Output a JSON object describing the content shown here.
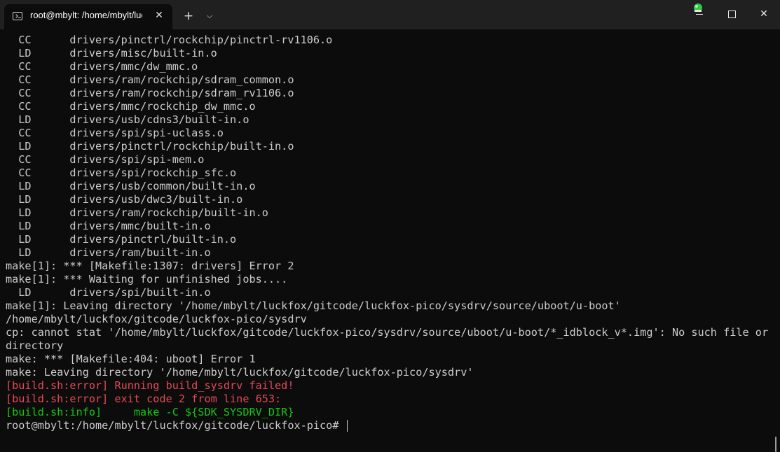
{
  "window": {
    "tab_title": "root@mbylt: /home/mbylt/luckfox/gitcode/luckfox-pico",
    "tab_close_glyph": "✕",
    "new_tab_glyph": "+",
    "dropdown_glyph": "⌵",
    "close_glyph": "✕"
  },
  "icons": {
    "tab": "terminal-icon",
    "status": "green-notification-icon",
    "minimize": "minimize-icon",
    "maximize": "maximize-icon",
    "close": "close-icon"
  },
  "colors": {
    "background": "#0c0c0c",
    "titlebar": "#202020",
    "text": "#cccccc",
    "error": "#e74856",
    "info": "#16c60c"
  },
  "terminal": {
    "lines": [
      {
        "text": "  CC      drivers/pinctrl/rockchip/pinctrl-rv1106.o",
        "style": "normal"
      },
      {
        "text": "  LD      drivers/misc/built-in.o",
        "style": "normal"
      },
      {
        "text": "  CC      drivers/mmc/dw_mmc.o",
        "style": "normal"
      },
      {
        "text": "  CC      drivers/ram/rockchip/sdram_common.o",
        "style": "normal"
      },
      {
        "text": "  CC      drivers/ram/rockchip/sdram_rv1106.o",
        "style": "normal"
      },
      {
        "text": "  CC      drivers/mmc/rockchip_dw_mmc.o",
        "style": "normal"
      },
      {
        "text": "  LD      drivers/usb/cdns3/built-in.o",
        "style": "normal"
      },
      {
        "text": "  CC      drivers/spi/spi-uclass.o",
        "style": "normal"
      },
      {
        "text": "  LD      drivers/pinctrl/rockchip/built-in.o",
        "style": "normal"
      },
      {
        "text": "  CC      drivers/spi/spi-mem.o",
        "style": "normal"
      },
      {
        "text": "  CC      drivers/spi/rockchip_sfc.o",
        "style": "normal"
      },
      {
        "text": "  LD      drivers/usb/common/built-in.o",
        "style": "normal"
      },
      {
        "text": "  LD      drivers/usb/dwc3/built-in.o",
        "style": "normal"
      },
      {
        "text": "  LD      drivers/ram/rockchip/built-in.o",
        "style": "normal"
      },
      {
        "text": "  LD      drivers/mmc/built-in.o",
        "style": "normal"
      },
      {
        "text": "  LD      drivers/pinctrl/built-in.o",
        "style": "normal"
      },
      {
        "text": "  LD      drivers/ram/built-in.o",
        "style": "normal"
      },
      {
        "text": "make[1]: *** [Makefile:1307: drivers] Error 2",
        "style": "normal"
      },
      {
        "text": "make[1]: *** Waiting for unfinished jobs....",
        "style": "normal"
      },
      {
        "text": "  LD      drivers/spi/built-in.o",
        "style": "normal"
      },
      {
        "text": "make[1]: Leaving directory '/home/mbylt/luckfox/gitcode/luckfox-pico/sysdrv/source/uboot/u-boot'",
        "style": "normal"
      },
      {
        "text": "/home/mbylt/luckfox/gitcode/luckfox-pico/sysdrv",
        "style": "normal"
      },
      {
        "text": "cp: cannot stat '/home/mbylt/luckfox/gitcode/luckfox-pico/sysdrv/source/uboot/u-boot/*_idblock_v*.img': No such file or",
        "style": "normal"
      },
      {
        "text": "directory",
        "style": "normal"
      },
      {
        "text": "make: *** [Makefile:404: uboot] Error 1",
        "style": "normal"
      },
      {
        "text": "make: Leaving directory '/home/mbylt/luckfox/gitcode/luckfox-pico/sysdrv'",
        "style": "normal"
      },
      {
        "text": "[build.sh:error] Running build_sysdrv failed!",
        "style": "err"
      },
      {
        "text": "[build.sh:error] exit code 2 from line 653:",
        "style": "err"
      },
      {
        "text": "[build.sh:info]     make -C ${SDK_SYSDRV_DIR}",
        "style": "info"
      }
    ],
    "prompt": "root@mbylt:/home/mbylt/luckfox/gitcode/luckfox-pico# "
  }
}
